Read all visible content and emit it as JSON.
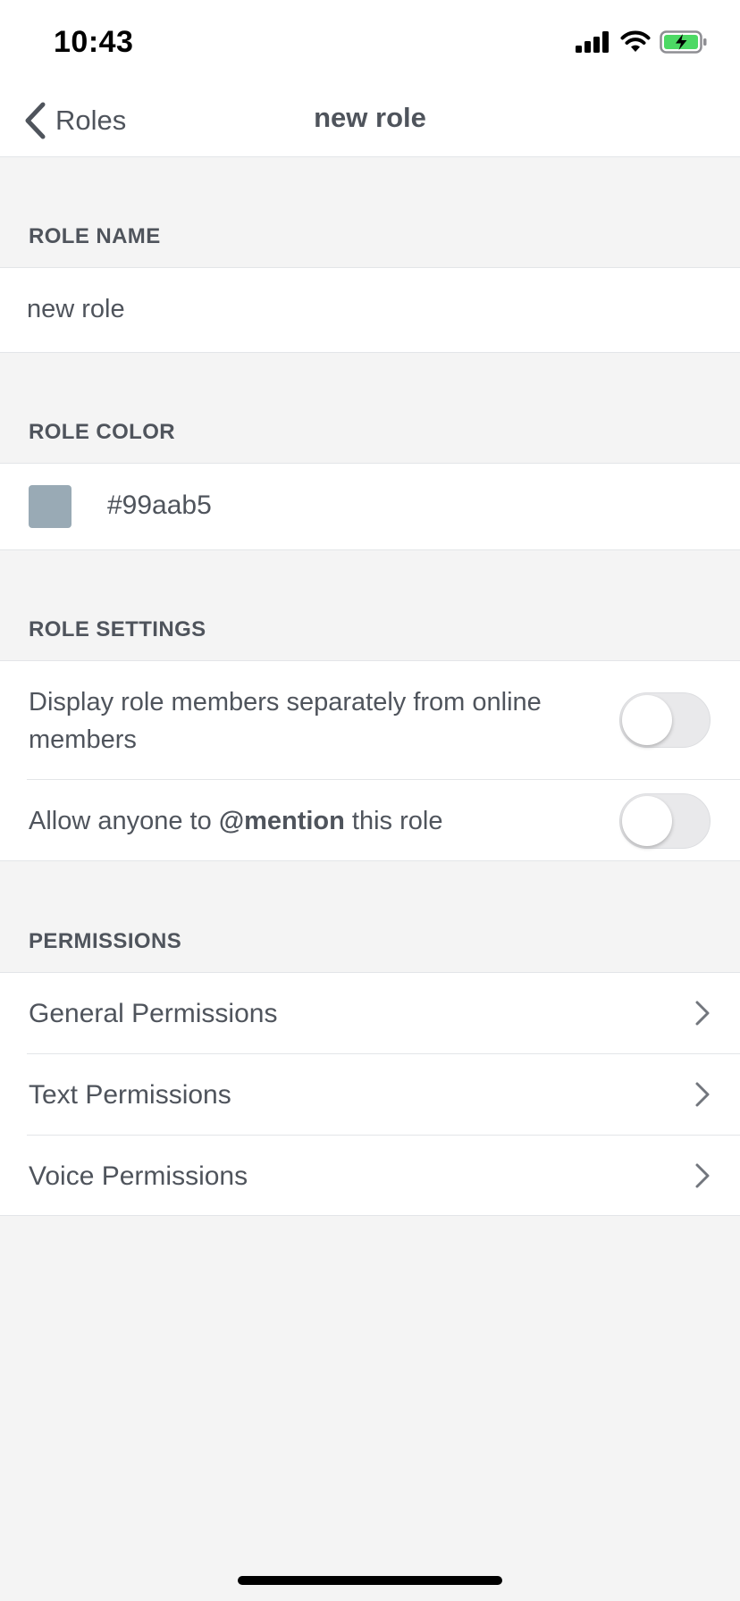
{
  "status_bar": {
    "time": "10:43"
  },
  "nav": {
    "back_label": "Roles",
    "title": "new role"
  },
  "role_name": {
    "header": "ROLE NAME",
    "value": "new role"
  },
  "role_color": {
    "header": "ROLE COLOR",
    "swatch_color": "#99aab5",
    "hex_label": "#99aab5"
  },
  "role_settings": {
    "header": "ROLE SETTINGS",
    "display_separately": {
      "label": "Display role members separately from online members",
      "enabled": false
    },
    "mentionable": {
      "label_prefix": "Allow anyone to ",
      "label_bold": "@mention",
      "label_suffix": " this role",
      "enabled": false
    }
  },
  "permissions": {
    "header": "PERMISSIONS",
    "items": [
      {
        "label": "General Permissions"
      },
      {
        "label": "Text Permissions"
      },
      {
        "label": "Voice Permissions"
      }
    ]
  }
}
